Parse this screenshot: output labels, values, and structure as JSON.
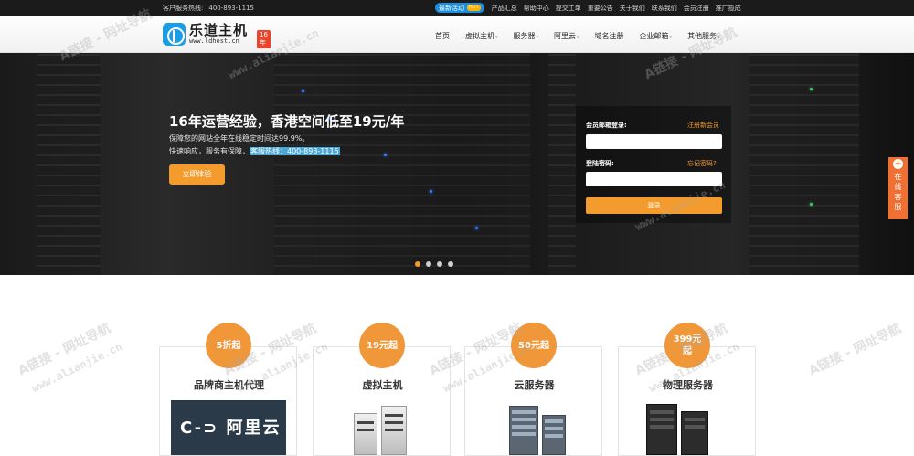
{
  "topbar": {
    "hotline_label": "客户服务热线:",
    "hotline_number": "400-893-1115",
    "promo_label": "最新活动",
    "promo_badge": "HOT",
    "links": [
      "产品汇总",
      "帮助中心",
      "提交工单",
      "重要公告",
      "关于我们",
      "联系我们",
      "会员注册",
      "推广揽成"
    ]
  },
  "logo": {
    "cn": "乐道主机",
    "url": "www.ldhost.cn",
    "badge": "16年"
  },
  "nav": {
    "items": [
      {
        "label": "首页",
        "has_caret": false
      },
      {
        "label": "虚拟主机",
        "has_caret": true
      },
      {
        "label": "服务器",
        "has_caret": true
      },
      {
        "label": "阿里云",
        "has_caret": true
      },
      {
        "label": "域名注册",
        "has_caret": false
      },
      {
        "label": "企业邮箱",
        "has_caret": true
      },
      {
        "label": "其他服务",
        "has_caret": true
      }
    ]
  },
  "hero": {
    "title": "16年运营经验，香港空间低至19元/年",
    "line1": "保障您的网站全年在线稳定时间达99.9%。",
    "line2_prefix": "快速响应，服务有保障，",
    "line2_highlight": "客服热线：400-893-1115",
    "cta": "立即体验",
    "slides_active": 0,
    "slides_count": 4
  },
  "login": {
    "account_label": "会员邮箱登录:",
    "register_link": "注册新会员",
    "password_label": "登陆密码:",
    "forgot_link": "忘记密码?",
    "submit_label": "登录",
    "account_value": "",
    "password_value": ""
  },
  "online_service": {
    "label": "在线客服"
  },
  "cards": [
    {
      "price": "5折起",
      "name": "品牌商主机代理",
      "image_text": "阿里云"
    },
    {
      "price": "19元起",
      "name": "虚拟主机"
    },
    {
      "price": "50元起",
      "name": "云服务器"
    },
    {
      "price": "399元起",
      "name": "物理服务器"
    }
  ],
  "watermarks": {
    "cn": "A链接 - 网址导航",
    "url": "www.alianjie.cn"
  },
  "colors": {
    "accent": "#f39b2d",
    "topbar_bg": "#1b1b1b",
    "brand_blue": "#1a9de6",
    "online_bg": "#f07034"
  }
}
